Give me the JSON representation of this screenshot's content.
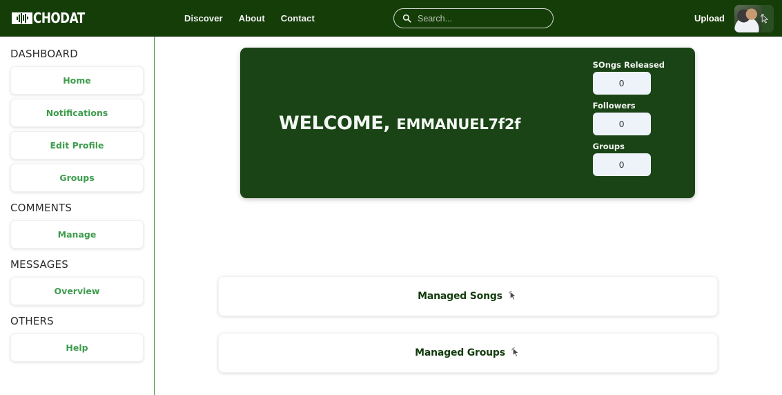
{
  "theme": {
    "header_green": "#153d08",
    "banner_green": "#1a4415",
    "accent_green": "#3d9c4c",
    "divider_green": "#3a8f33",
    "stat_box_bg": "#eef3fa",
    "panel_text": "#113b0c"
  },
  "header": {
    "logo_text": "CHODAT",
    "logo_icon": "audio-wave-badge-icon",
    "nav": [
      {
        "label": "Discover"
      },
      {
        "label": "About"
      },
      {
        "label": "Contact"
      }
    ],
    "search": {
      "icon": "search-icon",
      "value": "",
      "placeholder": "Search..."
    },
    "upload_label": "Upload",
    "avatar": {
      "alt": "user-avatar",
      "cursor_icon": "pointer-click-icon"
    }
  },
  "sidebar": {
    "sections": [
      {
        "title": "DASHBOARD",
        "items": [
          {
            "label": "Home"
          },
          {
            "label": "Notifications"
          },
          {
            "label": "Edit Profile"
          },
          {
            "label": "Groups"
          }
        ]
      },
      {
        "title": "COMMENTS",
        "items": [
          {
            "label": "Manage"
          }
        ]
      },
      {
        "title": "MESSAGES",
        "items": [
          {
            "label": "Overview"
          }
        ]
      },
      {
        "title": "OTHERS",
        "items": [
          {
            "label": "Help"
          }
        ]
      }
    ]
  },
  "main": {
    "banner": {
      "welcome_text": "WELCOME,",
      "username": "EMMANUEL7f2f",
      "stats": [
        {
          "label": "SOngs Released",
          "value": "0"
        },
        {
          "label": "Followers",
          "value": "0"
        },
        {
          "label": "Groups",
          "value": "0"
        }
      ]
    },
    "panels": [
      {
        "label": "Managed Songs",
        "cursor_icon": "pointer-click-icon"
      },
      {
        "label": "Managed Groups",
        "cursor_icon": "pointer-click-icon"
      }
    ]
  }
}
